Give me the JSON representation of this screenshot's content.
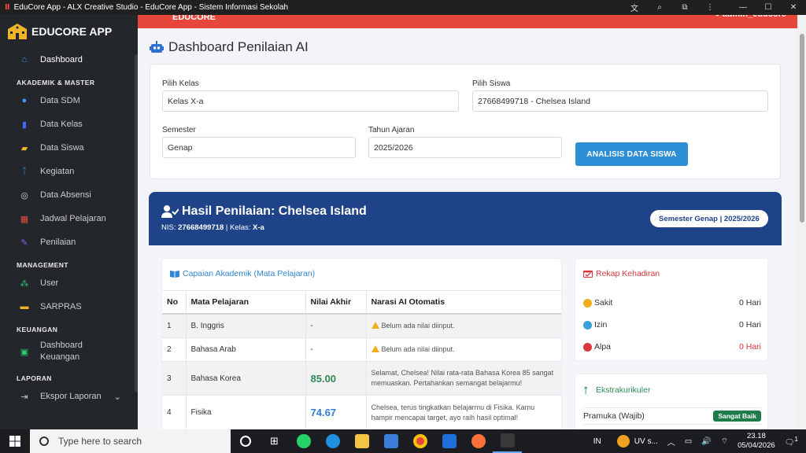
{
  "window": {
    "title": "EduCore App - ALX Creative Studio - EduCore App - Sistem Informasi Sekolah"
  },
  "topbar": {
    "brand_text": "EDUCORE",
    "user_text": "admin_educore"
  },
  "sidebar": {
    "brand": "EDUCORE APP",
    "items": [
      {
        "type": "item",
        "label": "Dashboard",
        "icon": "home-icon",
        "color": "#3aa0ff"
      },
      {
        "type": "section",
        "label": "AKADEMIK & MASTER"
      },
      {
        "type": "item",
        "label": "Data SDM",
        "icon": "user-icon",
        "color": "#3aa0ff"
      },
      {
        "type": "item",
        "label": "Data Kelas",
        "icon": "door-icon",
        "color": "#3a6cff"
      },
      {
        "type": "item",
        "label": "Data Siswa",
        "icon": "student-icon",
        "color": "#f0b429"
      },
      {
        "type": "item",
        "label": "Kegiatan",
        "icon": "running-icon",
        "color": "#3aa0ff"
      },
      {
        "type": "item",
        "label": "Data Absensi",
        "icon": "fingerprint-icon",
        "color": "#c9ccd1"
      },
      {
        "type": "item",
        "label": "Jadwal Pelajaran",
        "icon": "calendar-icon",
        "color": "#e34b3e"
      },
      {
        "type": "item",
        "label": "Penilaian",
        "icon": "pen-icon",
        "color": "#8b5cf6"
      },
      {
        "type": "section",
        "label": "MANAGEMENT"
      },
      {
        "type": "item",
        "label": "User",
        "icon": "users-icon",
        "color": "#2ecc71"
      },
      {
        "type": "item",
        "label": "SARPRAS",
        "icon": "box-icon",
        "color": "#f0b429"
      },
      {
        "type": "section",
        "label": "KEUANGAN"
      },
      {
        "type": "item2",
        "label": "Dashboard\nKeuangan",
        "icon": "money-icon",
        "color": "#2ecc71"
      },
      {
        "type": "section",
        "label": "LAPORAN"
      },
      {
        "type": "item",
        "label": "Ekspor Laporan",
        "icon": "export-icon",
        "color": "#c9ccd1"
      }
    ]
  },
  "page": {
    "title": "Dashboard Penilaian AI"
  },
  "filters": {
    "kelas_label": "Pilih Kelas",
    "kelas_value": "Kelas X-a",
    "siswa_label": "Pilih Siswa",
    "siswa_value": "27668499718 - Chelsea Island",
    "semester_label": "Semester",
    "semester_value": "Genap",
    "tahun_label": "Tahun Ajaran",
    "tahun_value": "2025/2026",
    "analyze_label": "ANALISIS DATA SISWA"
  },
  "result": {
    "title": "Hasil Penilaian: Chelsea Island",
    "nis_label": "NIS:",
    "nis": "27668499718",
    "kelas_label": "| Kelas:",
    "kelas": "X-a",
    "semester_badge": "Semester Genap | 2025/2026"
  },
  "academic": {
    "title": "Capaian Akademik (Mata Pelajaran)",
    "headers": [
      "No",
      "Mata Pelajaran",
      "Nilai Akhir",
      "Narasi AI Otomatis"
    ],
    "rows": [
      {
        "no": "1",
        "subject": "B. Inggris",
        "score": "-",
        "note": "Belum ada nilai diinput.",
        "warn": true
      },
      {
        "no": "2",
        "subject": "Bahasa Arab",
        "score": "-",
        "note": "Belum ada nilai diinput.",
        "warn": true
      },
      {
        "no": "3",
        "subject": "Bahasa Korea",
        "score": "85.00",
        "note": "Selamat, Chelsea! Nilai rata-rata Bahasa Korea 85 sangat memuaskan. Pertahankan semangat belajarmu!",
        "warn": false,
        "color": "green"
      },
      {
        "no": "4",
        "subject": "Fisika",
        "score": "74.67",
        "note": "Chelsea, terus tingkatkan belajarmu di Fisika. Kamu hampir mencapai target, ayo raih hasil optimal!",
        "warn": false,
        "color": "blue"
      }
    ]
  },
  "attendance": {
    "title": "Rekap Kehadiran",
    "items": [
      {
        "label": "Sakit",
        "value": "0 Hari",
        "color": "#f0ad1c",
        "value_color": "#333333"
      },
      {
        "label": "Izin",
        "value": "0 Hari",
        "color": "#3aa0d8",
        "value_color": "#333333"
      },
      {
        "label": "Alpa",
        "value": "0 Hari",
        "color": "#d9363e",
        "value_color": "#d9363e"
      }
    ]
  },
  "extracurricular": {
    "title": "Ekstrakurikuler",
    "items": [
      {
        "name": "Pramuka (Wajib)",
        "grade": "Sangat Baik"
      }
    ]
  },
  "taskbar": {
    "search_placeholder": "Type here to search",
    "lang": "IN",
    "weather": "UV s...",
    "time": "23.18",
    "date": "05/04/2026",
    "notif_count": "1"
  }
}
